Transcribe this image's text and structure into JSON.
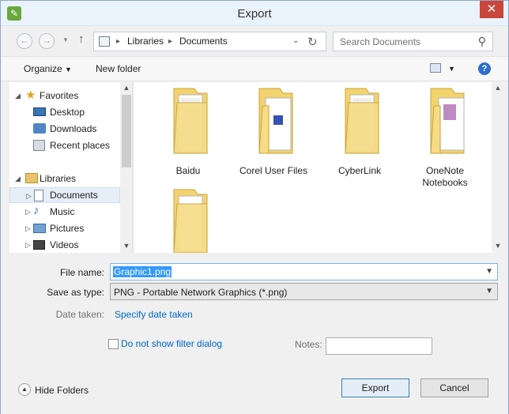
{
  "window": {
    "title": "Export"
  },
  "address": {
    "crumbs": [
      "Libraries",
      "Documents"
    ],
    "search_placeholder": "Search Documents"
  },
  "toolbar": {
    "organize": "Organize",
    "new_folder": "New folder"
  },
  "nav": {
    "items": [
      {
        "label": "Favorites",
        "icon": "star-icon",
        "type": "group"
      },
      {
        "label": "Desktop",
        "icon": "desktop-icon"
      },
      {
        "label": "Downloads",
        "icon": "downloads-icon"
      },
      {
        "label": "Recent places",
        "icon": "recent-places-icon"
      },
      {
        "label": "Libraries",
        "icon": "libraries-icon",
        "type": "group"
      },
      {
        "label": "Documents",
        "icon": "documents-icon",
        "selected": true
      },
      {
        "label": "Music",
        "icon": "music-icon"
      },
      {
        "label": "Pictures",
        "icon": "pictures-icon"
      },
      {
        "label": "Videos",
        "icon": "videos-icon"
      }
    ]
  },
  "folders": [
    {
      "label": "Baidu"
    },
    {
      "label": "Corel User Files"
    },
    {
      "label": "CyberLink"
    },
    {
      "label": "OneNote Notebooks"
    },
    {
      "label": ""
    }
  ],
  "form": {
    "file_name_label": "File name:",
    "file_name_value": "Graphic1.png",
    "save_type_label": "Save as type:",
    "save_type_value": "PNG - Portable Network Graphics (*.png)",
    "date_taken_label": "Date taken:",
    "date_taken_link": "Specify date taken",
    "filter_label": "Do not show filter dialog",
    "notes_label": "Notes:"
  },
  "footer": {
    "hide_folders": "Hide Folders",
    "export": "Export",
    "cancel": "Cancel"
  },
  "colors": {
    "accent": "#3399ff",
    "link": "#0066cc",
    "close": "#c9463d"
  }
}
